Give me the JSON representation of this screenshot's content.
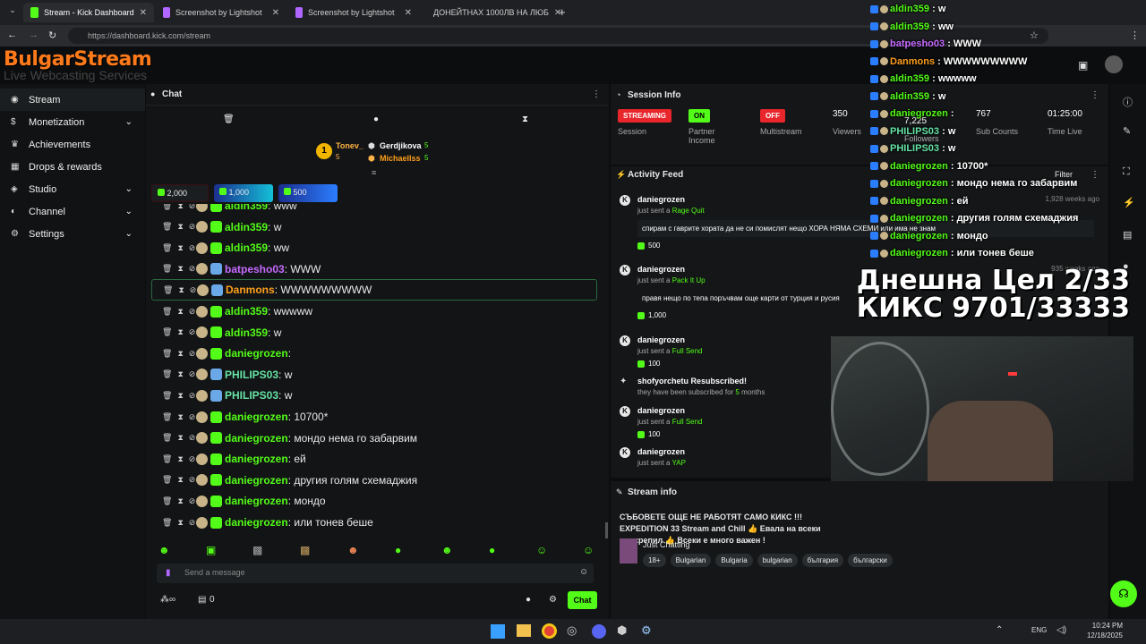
{
  "browser": {
    "tabs": [
      {
        "title": "Stream - Kick Dashboard",
        "color": "#53fc18",
        "active": true
      },
      {
        "title": "Screenshot by Lightshot",
        "color": "#b066ff"
      },
      {
        "title": "Screenshot by Lightshot",
        "color": "#b066ff"
      },
      {
        "title": "ДОНЕЙТНАХ 1000ЛВ НА ЛЮБ",
        "color": "#ff2b2b"
      }
    ],
    "url": "https://dashboard.kick.com/stream"
  },
  "brand": {
    "logo_title": "BulgarStream",
    "logo_sub": "Live Webcasting Services"
  },
  "sidebar": {
    "items": [
      {
        "label": "Stream",
        "icon": "broadcast-icon"
      },
      {
        "label": "Monetization",
        "icon": "dollar-icon"
      },
      {
        "label": "Achievements",
        "icon": "trophy-icon"
      },
      {
        "label": "Drops & rewards",
        "icon": "gift-icon"
      },
      {
        "label": "Studio",
        "icon": "film-icon"
      },
      {
        "label": "Channel",
        "icon": "user-icon"
      },
      {
        "label": "Settings",
        "icon": "gear-icon"
      }
    ]
  },
  "chat": {
    "title": "Chat",
    "top_user": "Tonev_",
    "top_user_count": "5",
    "leaders": [
      {
        "name": "Gerdjikova",
        "count": "5"
      },
      {
        "name": "Michaellss",
        "count": "5"
      }
    ],
    "goals": [
      "2,000",
      "1,000",
      "500"
    ],
    "messages": [
      {
        "user": "aldin359",
        "text": "www",
        "color": "#53fc18"
      },
      {
        "user": "aldin359",
        "text": "w",
        "color": "#53fc18"
      },
      {
        "user": "aldin359",
        "text": "ww",
        "color": "#53fc18"
      },
      {
        "user": "batpesho03",
        "text": "WWW",
        "color": "#c66bff"
      },
      {
        "user": "Danmons",
        "text": "WWWWWWWWW",
        "color": "#ff9f1c"
      },
      {
        "user": "aldin359",
        "text": "wwwww",
        "color": "#53fc18"
      },
      {
        "user": "aldin359",
        "text": "w",
        "color": "#53fc18"
      },
      {
        "user": "daniegrozen",
        "text": "",
        "color": "#53fc18"
      },
      {
        "user": "PHILIPS03",
        "text": "w",
        "color": "#66e3a6"
      },
      {
        "user": "PHILIPS03",
        "text": "w",
        "color": "#66e3a6"
      },
      {
        "user": "daniegrozen",
        "text": "10700*",
        "color": "#53fc18"
      },
      {
        "user": "daniegrozen",
        "text": "мондо нема го забарвим",
        "color": "#53fc18"
      },
      {
        "user": "daniegrozen",
        "text": "ей",
        "color": "#53fc18"
      },
      {
        "user": "daniegrozen",
        "text": "другия голям схемаджия",
        "color": "#53fc18"
      },
      {
        "user": "daniegrozen",
        "text": "мондо",
        "color": "#53fc18"
      },
      {
        "user": "daniegrozen",
        "text": "или тонев беше",
        "color": "#53fc18"
      }
    ],
    "input_placeholder": "Send a message",
    "viewers_count": "0",
    "send_label": "Chat"
  },
  "session": {
    "title": "Session Info",
    "streaming_label": "STREAMING",
    "session_label": "Session",
    "partner_value": "ON",
    "partner_label": "Partner Income",
    "multistream_value": "OFF",
    "multistream_label": "Multistream",
    "viewers_value": "350",
    "viewers_label": "Viewers",
    "followers_value": "7,225",
    "followers_label": "Followers",
    "subs_value": "767",
    "subs_label": "Sub Counts",
    "time_value": "01:25:00",
    "time_label": "Time Live"
  },
  "activity": {
    "title": "Activity Feed",
    "filter_label": "Filter",
    "items": [
      {
        "user": "daniegrozen",
        "prefix": "just sent a",
        "action": "Rage Quit",
        "time": "1,928 weeks ago",
        "message": "спирам с гаврите хората да не си помислят нещо ХОРА НЯМА СХЕМИ или има не знам",
        "amount": "500"
      },
      {
        "user": "daniegrozen",
        "prefix": "just sent a",
        "action": "Pack It Up",
        "time": "935 weeks ago",
        "message": "правя нещо по тепа поръчвам още карти от турция и русия",
        "amount": "1,000"
      },
      {
        "user": "daniegrozen",
        "prefix": "just sent a",
        "action": "Full Send",
        "amount": "100"
      },
      {
        "user": "shofyorchetu Resubscribed!",
        "prefix": "they have been subscribed for",
        "action": "5",
        "suffix": "months"
      },
      {
        "user": "daniegrozen",
        "prefix": "just sent a",
        "action": "Full Send",
        "amount": "100"
      },
      {
        "user": "daniegrozen",
        "prefix": "just sent a",
        "action": "YAP"
      }
    ]
  },
  "stream_info": {
    "title": "Stream info",
    "stream_title": "СЪБОВЕТЕ ОЩЕ НЕ РАБОТЯТ САМО КИКС !!! EXPEDITION 33 Stream and Chill 👍 Евала на всеки подкрепил 👍 Всеки е много важен !",
    "category": "Just Chatting",
    "tags": [
      "18+",
      "Bulgarian",
      "Bulgaria",
      "bulgarian",
      "българия",
      "български"
    ]
  },
  "overlay": {
    "goal_line1": "Днешна Цел 2/33",
    "goal_line2": "КИКС 9701/33333",
    "messages": [
      {
        "user": "aldin359",
        "text": "w",
        "color": "#53fc18"
      },
      {
        "user": "aldin359",
        "text": "ww",
        "color": "#53fc18"
      },
      {
        "user": "batpesho03",
        "text": "WWW",
        "color": "#c66bff"
      },
      {
        "user": "Danmons",
        "text": "WWWWWWWWW",
        "color": "#ff9f1c"
      },
      {
        "user": "aldin359",
        "text": "wwwww",
        "color": "#53fc18"
      },
      {
        "user": "aldin359",
        "text": "w",
        "color": "#53fc18"
      },
      {
        "user": "daniegrozen",
        "text": "",
        "color": "#53fc18"
      },
      {
        "user": "PHILIPS03",
        "text": "w",
        "color": "#66e3a6"
      },
      {
        "user": "PHILIPS03",
        "text": "w",
        "color": "#66e3a6"
      },
      {
        "user": "daniegrozen",
        "text": "10700*",
        "color": "#53fc18"
      },
      {
        "user": "daniegrozen",
        "text": "мондо нема го забарвим",
        "color": "#53fc18"
      },
      {
        "user": "daniegrozen",
        "text": "ей",
        "color": "#53fc18"
      },
      {
        "user": "daniegrozen",
        "text": "другия голям схемаджия",
        "color": "#53fc18"
      },
      {
        "user": "daniegrozen",
        "text": "мондо",
        "color": "#53fc18"
      },
      {
        "user": "daniegrozen",
        "text": "или тонев беше",
        "color": "#53fc18"
      }
    ]
  },
  "taskbar": {
    "lang": "ENG",
    "time": "10:24 PM",
    "date": "12/18/2025"
  },
  "colors": {
    "accent": "#53fc18",
    "danger": "#e8262c",
    "bg": "#0b0d0e",
    "panel": "#141617"
  }
}
